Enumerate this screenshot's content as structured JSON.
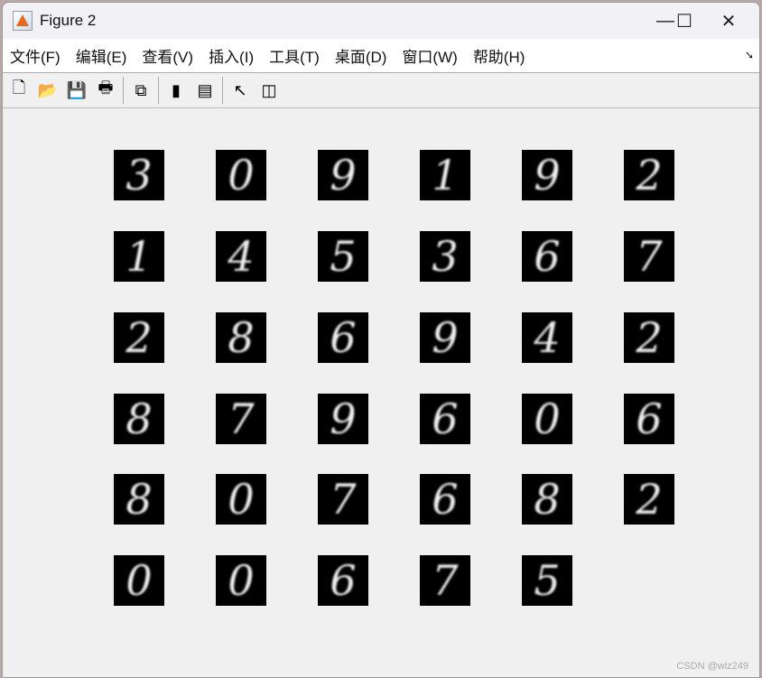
{
  "window": {
    "title": "Figure 2"
  },
  "menu": [
    "文件(F)",
    "编辑(E)",
    "查看(V)",
    "插入(I)",
    "工具(T)",
    "桌面(D)",
    "窗口(W)",
    "帮助(H)"
  ],
  "toolbar": [
    "new-figure",
    "open-file",
    "save",
    "print",
    "link-plot",
    "insert-colorbar",
    "insert-legend",
    "edit-plot",
    "property-inspector"
  ],
  "digits": [
    [
      "3",
      "0",
      "9",
      "1",
      "9",
      "2"
    ],
    [
      "1",
      "4",
      "5",
      "3",
      "6",
      "7"
    ],
    [
      "2",
      "8",
      "6",
      "9",
      "4",
      "2"
    ],
    [
      "8",
      "7",
      "9",
      "6",
      "0",
      "6"
    ],
    [
      "8",
      "0",
      "7",
      "6",
      "8",
      "2"
    ],
    [
      "0",
      "0",
      "6",
      "7",
      "5"
    ]
  ],
  "watermark": "CSDN @wlz249"
}
